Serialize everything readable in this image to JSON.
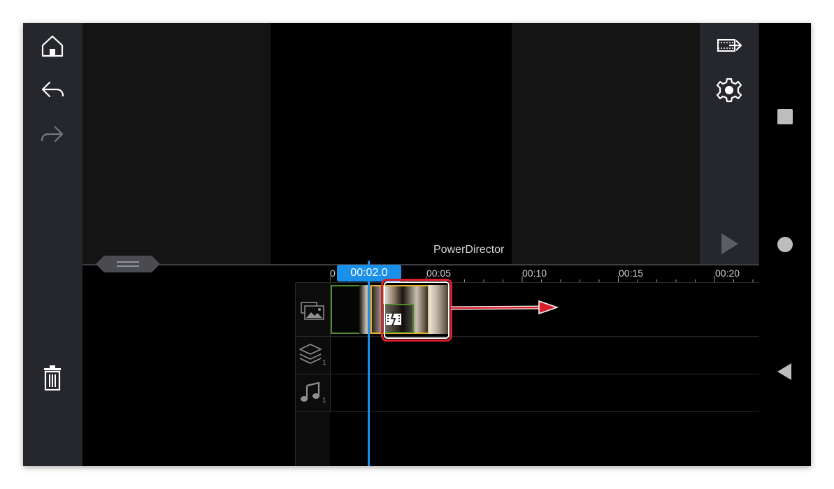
{
  "preview": {
    "watermark": "PowerDirector"
  },
  "timeline": {
    "current_time": "00:02.0",
    "ticks": [
      "0",
      "00:05",
      "00:10",
      "00:15",
      "00:20"
    ],
    "tracks": [
      {
        "name": "video-track",
        "icon": "media-icon"
      },
      {
        "name": "overlay-track",
        "icon": "layers-icon",
        "count": "1"
      },
      {
        "name": "audio-track",
        "icon": "music-icon",
        "count": "1"
      }
    ]
  },
  "left_toolbar": {
    "icons": [
      "home-icon",
      "undo-icon",
      "redo-icon",
      "trash-icon"
    ]
  },
  "right_toolbar": {
    "icons": [
      "export-icon",
      "settings-icon",
      "play-icon"
    ]
  },
  "nav_bar": {
    "icons": [
      "recents-icon",
      "home-circle-icon",
      "back-icon"
    ]
  },
  "colors": {
    "accent": "#1b90ea",
    "highlight": "#d9202a",
    "clip_gold": "#e3b02b",
    "clip_green": "#4f8b2a"
  }
}
